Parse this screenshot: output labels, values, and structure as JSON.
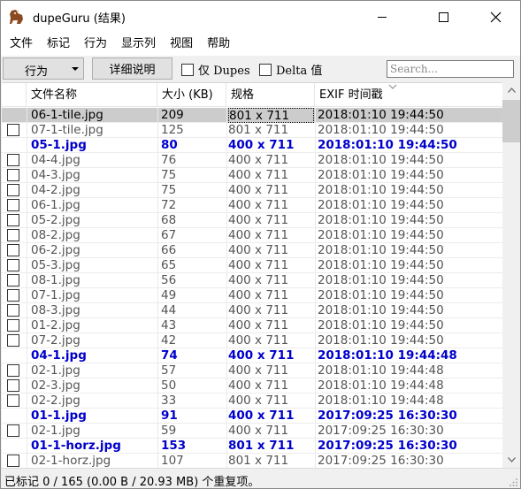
{
  "window": {
    "title": "dupeGuru (结果)"
  },
  "menu": [
    "文件",
    "标记",
    "行为",
    "显示列",
    "视图",
    "帮助"
  ],
  "toolbar": {
    "action_label": "行为",
    "details_label": "详细说明",
    "dupes_only_label": "仅 Dupes",
    "delta_label": "Delta 值",
    "search_placeholder": "Search..."
  },
  "columns": {
    "name": "文件名称",
    "size": "大小 (KB)",
    "dimensions": "规格",
    "exif": "EXIF 时间戳"
  },
  "rows": [
    {
      "name": "06-1-tile.jpg",
      "size": "209",
      "dim": "801 x 711",
      "exif": "2018:01:10 19:44:50",
      "type": "selected"
    },
    {
      "name": "07-1-tile.jpg",
      "size": "125",
      "dim": "801 x 711",
      "exif": "2018:01:10 19:44:50",
      "type": "dupe"
    },
    {
      "name": "05-1.jpg",
      "size": "80",
      "dim": "400 x 711",
      "exif": "2018:01:10 19:44:50",
      "type": "ref"
    },
    {
      "name": "04-4.jpg",
      "size": "76",
      "dim": "400 x 711",
      "exif": "2018:01:10 19:44:50",
      "type": "dupe"
    },
    {
      "name": "04-3.jpg",
      "size": "75",
      "dim": "400 x 711",
      "exif": "2018:01:10 19:44:50",
      "type": "dupe"
    },
    {
      "name": "04-2.jpg",
      "size": "75",
      "dim": "400 x 711",
      "exif": "2018:01:10 19:44:50",
      "type": "dupe"
    },
    {
      "name": "06-1.jpg",
      "size": "72",
      "dim": "400 x 711",
      "exif": "2018:01:10 19:44:50",
      "type": "dupe"
    },
    {
      "name": "05-2.jpg",
      "size": "68",
      "dim": "400 x 711",
      "exif": "2018:01:10 19:44:50",
      "type": "dupe"
    },
    {
      "name": "08-2.jpg",
      "size": "67",
      "dim": "400 x 711",
      "exif": "2018:01:10 19:44:50",
      "type": "dupe"
    },
    {
      "name": "06-2.jpg",
      "size": "66",
      "dim": "400 x 711",
      "exif": "2018:01:10 19:44:50",
      "type": "dupe"
    },
    {
      "name": "05-3.jpg",
      "size": "65",
      "dim": "400 x 711",
      "exif": "2018:01:10 19:44:50",
      "type": "dupe"
    },
    {
      "name": "08-1.jpg",
      "size": "56",
      "dim": "400 x 711",
      "exif": "2018:01:10 19:44:50",
      "type": "dupe"
    },
    {
      "name": "07-1.jpg",
      "size": "49",
      "dim": "400 x 711",
      "exif": "2018:01:10 19:44:50",
      "type": "dupe"
    },
    {
      "name": "08-3.jpg",
      "size": "44",
      "dim": "400 x 711",
      "exif": "2018:01:10 19:44:50",
      "type": "dupe"
    },
    {
      "name": "01-2.jpg",
      "size": "43",
      "dim": "400 x 711",
      "exif": "2018:01:10 19:44:50",
      "type": "dupe"
    },
    {
      "name": "07-2.jpg",
      "size": "42",
      "dim": "400 x 711",
      "exif": "2018:01:10 19:44:50",
      "type": "dupe"
    },
    {
      "name": "04-1.jpg",
      "size": "74",
      "dim": "400 x 711",
      "exif": "2018:01:10 19:44:48",
      "type": "ref"
    },
    {
      "name": "02-1.jpg",
      "size": "57",
      "dim": "400 x 711",
      "exif": "2018:01:10 19:44:48",
      "type": "dupe"
    },
    {
      "name": "02-3.jpg",
      "size": "50",
      "dim": "400 x 711",
      "exif": "2018:01:10 19:44:48",
      "type": "dupe"
    },
    {
      "name": "02-2.jpg",
      "size": "33",
      "dim": "400 x 711",
      "exif": "2018:01:10 19:44:48",
      "type": "dupe"
    },
    {
      "name": "01-1.jpg",
      "size": "91",
      "dim": "400 x 711",
      "exif": "2017:09:25 16:30:30",
      "type": "ref"
    },
    {
      "name": "02-1.jpg",
      "size": "59",
      "dim": "400 x 711",
      "exif": "2017:09:25 16:30:30",
      "type": "dupe"
    },
    {
      "name": "01-1-horz.jpg",
      "size": "153",
      "dim": "801 x 711",
      "exif": "2017:09:25 16:30:30",
      "type": "ref"
    },
    {
      "name": "02-1-horz.jpg",
      "size": "107",
      "dim": "801 x 711",
      "exif": "2017:09:25 16:30:30",
      "type": "dupe"
    }
  ],
  "status": "已标记 0 / 165 (0.00 B / 20.93 MB) 个重复项。",
  "colors": {
    "ref_text": "#0000cc",
    "dupe_text": "#555555",
    "selected_row": "#cccccc"
  }
}
